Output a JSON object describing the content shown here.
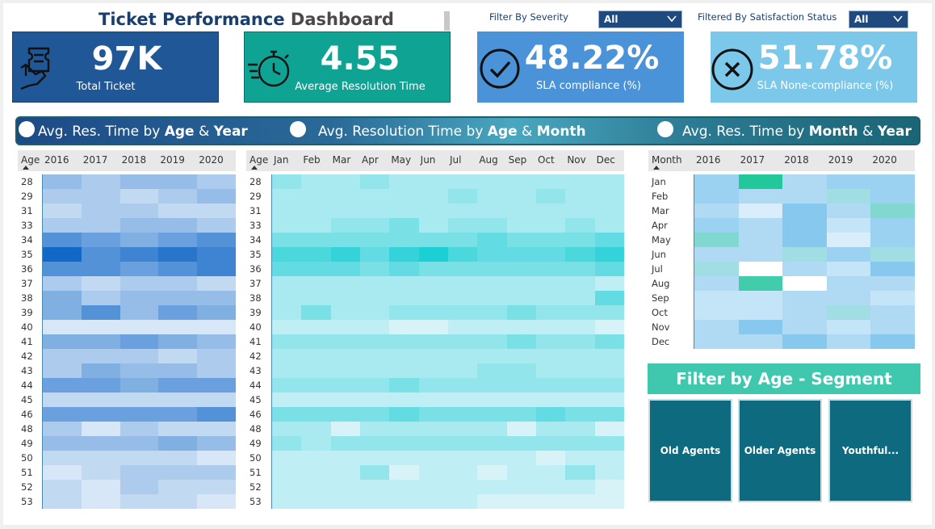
{
  "dashboard": {
    "title_part1": "Ticket Performance",
    "title_part2": "Dashboard"
  },
  "filters": {
    "severity": {
      "label": "Filter By Severity",
      "value": "All"
    },
    "satisfaction": {
      "label": "Filtered By Satisfaction Status",
      "value": "All"
    }
  },
  "kpis": [
    {
      "value": "97K",
      "label": "Total Ticket",
      "color": "#1f5797",
      "icon": "ticket-hand-icon"
    },
    {
      "value": "4.55",
      "label": "Average Resolution Time",
      "color": "#0fa394",
      "icon": "stopwatch-icon"
    },
    {
      "value": "48.22%",
      "label": "SLA compliance (%)",
      "color": "#4a93d8",
      "icon": "check-circle-icon"
    },
    {
      "value": "51.78%",
      "label": "SLA None-compliance (%)",
      "color": "#7cc8ea",
      "icon": "x-circle-icon"
    }
  ],
  "tabs": [
    {
      "pre": "Avg. Res. Time by ",
      "b1": "Age",
      "mid": " & ",
      "b2": "Year"
    },
    {
      "pre": "Avg. Resolution Time by ",
      "b1": "Age",
      "mid": " & ",
      "b2": "Month"
    },
    {
      "pre": "Avg. Res. Time by ",
      "b1": "Month",
      "mid": " & ",
      "b2": "Year"
    }
  ],
  "heatmaps": {
    "age_year": {
      "corner": "Age",
      "columns": [
        "2016",
        "2017",
        "2018",
        "2019",
        "2020"
      ],
      "rows": [
        "28",
        "29",
        "31",
        "33",
        "34",
        "35",
        "36",
        "37",
        "38",
        "39",
        "40",
        "41",
        "42",
        "43",
        "44",
        "45",
        "46",
        "48",
        "49",
        "50",
        "51",
        "52",
        "53"
      ],
      "values": [
        [
          4,
          3,
          4,
          4,
          3
        ],
        [
          3,
          3,
          2,
          3,
          4
        ],
        [
          2,
          3,
          3,
          2,
          2
        ],
        [
          3,
          3,
          4,
          4,
          3
        ],
        [
          7,
          6,
          5,
          6,
          7
        ],
        [
          10,
          7,
          8,
          9,
          8
        ],
        [
          7,
          7,
          6,
          7,
          8
        ],
        [
          3,
          2,
          3,
          3,
          2
        ],
        [
          5,
          3,
          4,
          4,
          4
        ],
        [
          5,
          7,
          4,
          6,
          5
        ],
        [
          1,
          1,
          1,
          1,
          1
        ],
        [
          5,
          5,
          6,
          5,
          4
        ],
        [
          3,
          3,
          3,
          2,
          3
        ],
        [
          3,
          5,
          4,
          4,
          3
        ],
        [
          6,
          6,
          5,
          6,
          6
        ],
        [
          2,
          2,
          2,
          2,
          2
        ],
        [
          6,
          6,
          6,
          6,
          7
        ],
        [
          3,
          1,
          3,
          2,
          2
        ],
        [
          4,
          4,
          4,
          5,
          4
        ],
        [
          2,
          2,
          2,
          2,
          1
        ],
        [
          1,
          2,
          3,
          3,
          3
        ],
        [
          2,
          1,
          3,
          2,
          2
        ],
        [
          2,
          1,
          2,
          2,
          1
        ]
      ]
    },
    "age_month": {
      "corner": "Age",
      "columns": [
        "Jan",
        "Feb",
        "Mar",
        "Apr",
        "May",
        "Jun",
        "Jul",
        "Aug",
        "Sep",
        "Oct",
        "Nov",
        "Dec"
      ],
      "rows": [
        "28",
        "29",
        "31",
        "33",
        "34",
        "35",
        "36",
        "37",
        "38",
        "39",
        "40",
        "41",
        "42",
        "43",
        "44",
        "45",
        "46",
        "48",
        "49",
        "50",
        "51",
        "52",
        "53"
      ],
      "values": [
        [
          4,
          3,
          3,
          4,
          3,
          3,
          3,
          3,
          3,
          3,
          3,
          3
        ],
        [
          3,
          3,
          3,
          3,
          3,
          3,
          4,
          3,
          3,
          4,
          3,
          3
        ],
        [
          3,
          3,
          3,
          3,
          3,
          3,
          3,
          3,
          3,
          3,
          3,
          3
        ],
        [
          3,
          3,
          4,
          4,
          5,
          3,
          4,
          4,
          3,
          3,
          4,
          3
        ],
        [
          5,
          5,
          5,
          5,
          5,
          5,
          5,
          6,
          5,
          5,
          5,
          6
        ],
        [
          7,
          7,
          8,
          6,
          8,
          9,
          7,
          6,
          6,
          6,
          7,
          8
        ],
        [
          6,
          6,
          6,
          5,
          6,
          5,
          5,
          5,
          5,
          5,
          5,
          6
        ],
        [
          3,
          3,
          3,
          3,
          3,
          3,
          3,
          3,
          3,
          3,
          3,
          2
        ],
        [
          3,
          3,
          3,
          3,
          3,
          3,
          3,
          3,
          3,
          3,
          3,
          6
        ],
        [
          3,
          5,
          3,
          3,
          4,
          4,
          4,
          4,
          5,
          4,
          4,
          4
        ],
        [
          2,
          2,
          2,
          2,
          1,
          1,
          2,
          2,
          2,
          2,
          2,
          1
        ],
        [
          4,
          4,
          4,
          4,
          4,
          4,
          4,
          4,
          5,
          4,
          4,
          5
        ],
        [
          3,
          3,
          3,
          3,
          3,
          3,
          3,
          3,
          3,
          3,
          3,
          3
        ],
        [
          3,
          3,
          3,
          3,
          3,
          3,
          3,
          4,
          4,
          3,
          3,
          3
        ],
        [
          4,
          4,
          4,
          4,
          5,
          4,
          4,
          4,
          4,
          4,
          4,
          4
        ],
        [
          2,
          2,
          2,
          2,
          2,
          2,
          2,
          2,
          2,
          2,
          2,
          2
        ],
        [
          5,
          5,
          5,
          5,
          6,
          5,
          5,
          5,
          5,
          6,
          5,
          5
        ],
        [
          3,
          3,
          1,
          3,
          3,
          3,
          3,
          3,
          1,
          3,
          3,
          1
        ],
        [
          4,
          3,
          4,
          4,
          4,
          4,
          4,
          4,
          4,
          4,
          4,
          4
        ],
        [
          2,
          2,
          2,
          2,
          2,
          2,
          2,
          2,
          2,
          1,
          2,
          2
        ],
        [
          2,
          2,
          2,
          4,
          1,
          2,
          2,
          1,
          2,
          2,
          4,
          2
        ],
        [
          2,
          2,
          2,
          2,
          2,
          2,
          2,
          2,
          2,
          2,
          2,
          1
        ],
        [
          2,
          2,
          2,
          2,
          2,
          2,
          2,
          1,
          1,
          1,
          1,
          1
        ]
      ]
    },
    "month_year": {
      "corner": "Month",
      "columns": [
        "2016",
        "2017",
        "2018",
        "2019",
        "2020"
      ],
      "rows": [
        "Jan",
        "Feb",
        "Mar",
        "Apr",
        "May",
        "Jun",
        "Jul",
        "Aug",
        "Sep",
        "Oct",
        "Nov",
        "Dec"
      ],
      "values": [
        [
          4,
          10,
          3,
          4,
          4
        ],
        [
          4,
          3,
          3,
          6,
          4
        ],
        [
          3,
          1,
          5,
          3,
          7
        ],
        [
          4,
          3,
          5,
          2,
          4
        ],
        [
          7,
          3,
          5,
          1,
          4
        ],
        [
          3,
          3,
          6,
          4,
          6
        ],
        [
          6,
          0,
          3,
          2,
          5
        ],
        [
          3,
          9,
          0,
          3,
          3
        ],
        [
          2,
          2,
          3,
          3,
          2
        ],
        [
          2,
          2,
          3,
          6,
          3
        ],
        [
          3,
          5,
          3,
          2,
          3
        ],
        [
          3,
          3,
          5,
          3,
          5
        ]
      ]
    }
  },
  "segment": {
    "title": "Filter by Age - Segment",
    "buttons": [
      "Old Agents",
      "Older Agents",
      "Youthful..."
    ]
  },
  "colors": {
    "heat_blue_low": "#eef5fd",
    "heat_blue_high": "#1268c7",
    "heat_teal_low": "#eef7fd",
    "heat_teal_high": "#1ccfd4",
    "heat_green_high": "#22c79a"
  }
}
